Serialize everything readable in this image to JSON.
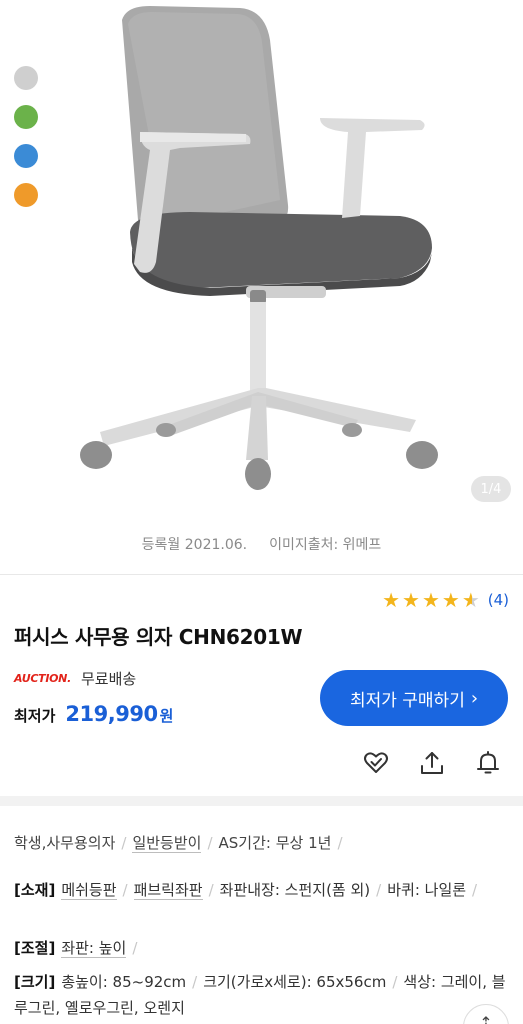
{
  "gallery": {
    "swatches": [
      {
        "name": "grey",
        "color": "#cfcfcf"
      },
      {
        "name": "green",
        "color": "#6bb24a"
      },
      {
        "name": "blue",
        "color": "#3b8bd6"
      },
      {
        "name": "orange",
        "color": "#ef9a2a"
      }
    ],
    "page_counter": "1/4"
  },
  "meta": {
    "registered": "등록월 2021.06.",
    "image_source": "이미지출처: 위메프"
  },
  "rating": {
    "stars": 4.5,
    "review_count": "(4)"
  },
  "product": {
    "title": "퍼시스 사무용 의자 CHN6201W"
  },
  "seller": {
    "logo": "AUCTION.",
    "shipping": "무료배송"
  },
  "price": {
    "label": "최저가",
    "value": "219,990",
    "unit": "원"
  },
  "buy_button": {
    "label": "최저가 구매하기",
    "chevron": "›"
  },
  "actions": {
    "icons": [
      "heart-check-icon",
      "share-icon",
      "bell-icon"
    ]
  },
  "tags": {
    "items": [
      "학생,사무용의자",
      "일반등받이",
      "AS기간: 무상 1년"
    ]
  },
  "specs": {
    "material": {
      "label": "[소재]",
      "items": [
        "메쉬등판",
        "패브릭좌판",
        "좌판내장: 스펀지(폼 외)",
        "바퀴: 나일론"
      ]
    },
    "adjust": {
      "label": "[조절]",
      "items": [
        "좌판: 높이"
      ]
    },
    "size": {
      "label": "[크기]",
      "items": [
        "총높이: 85~92cm",
        "크기(가로x세로): 65x56cm",
        "색상: 그레이, 블루그린, 옐로우그린, 오렌지"
      ]
    }
  },
  "colors": {
    "accent": "#1a66e0",
    "price": "#1a5fd6",
    "star": "#f3b51c",
    "auction": "#e2231a"
  }
}
